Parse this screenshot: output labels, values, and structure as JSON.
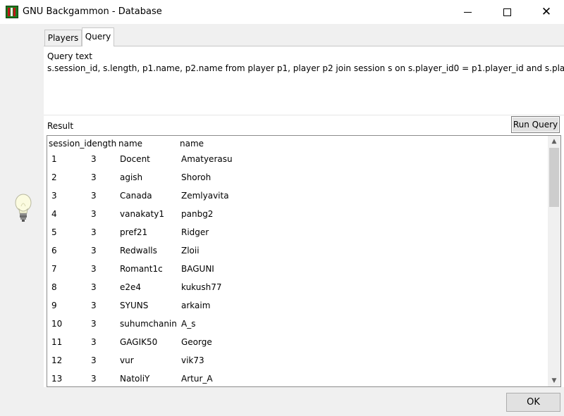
{
  "window": {
    "title": "GNU Backgammon - Database",
    "minimize_glyph": "",
    "close_glyph": "✕"
  },
  "tabs": [
    {
      "label": "Players",
      "active": false
    },
    {
      "label": "Query",
      "active": true
    }
  ],
  "query": {
    "label": "Query text",
    "text": "s.session_id, s.length, p1.name, p2.name from player p1, player p2 join session s on s.player_id0 = p1.player_id and s.pla"
  },
  "result": {
    "label": "Result",
    "run_button": "Run Query",
    "columns": [
      "session_id",
      "length",
      "name",
      "name"
    ],
    "rows": [
      [
        "1",
        "3",
        "Docent",
        "Amatyerasu"
      ],
      [
        "2",
        "3",
        "agish",
        "Shoroh"
      ],
      [
        "3",
        "3",
        "Canada",
        "Zemlyavita"
      ],
      [
        "4",
        "3",
        "vanakaty1",
        "panbg2"
      ],
      [
        "5",
        "3",
        "pref21",
        "Ridger"
      ],
      [
        "6",
        "3",
        "Redwalls",
        "Zloii"
      ],
      [
        "7",
        "3",
        "Romant1c",
        "BAGUNI"
      ],
      [
        "8",
        "3",
        "e2e4",
        "kukush77"
      ],
      [
        "9",
        "3",
        "SYUNS",
        "arkaim"
      ],
      [
        "10",
        "3",
        "suhumchanin",
        "A_s"
      ],
      [
        "11",
        "3",
        "GAGIK50",
        "George"
      ],
      [
        "12",
        "3",
        "vur",
        "vik73"
      ],
      [
        "13",
        "3",
        "NatoliY",
        "Artur_A"
      ]
    ]
  },
  "footer": {
    "ok_button": "OK"
  },
  "icons": {
    "app": "backgammon-board-icon",
    "hint": "lightbulb-icon",
    "scroll_up": "▲",
    "scroll_down": "▼"
  },
  "colors": {
    "window_bg": "#f0f0f0",
    "pane_bg": "#ffffff",
    "button_bg": "#e1e1e1"
  }
}
